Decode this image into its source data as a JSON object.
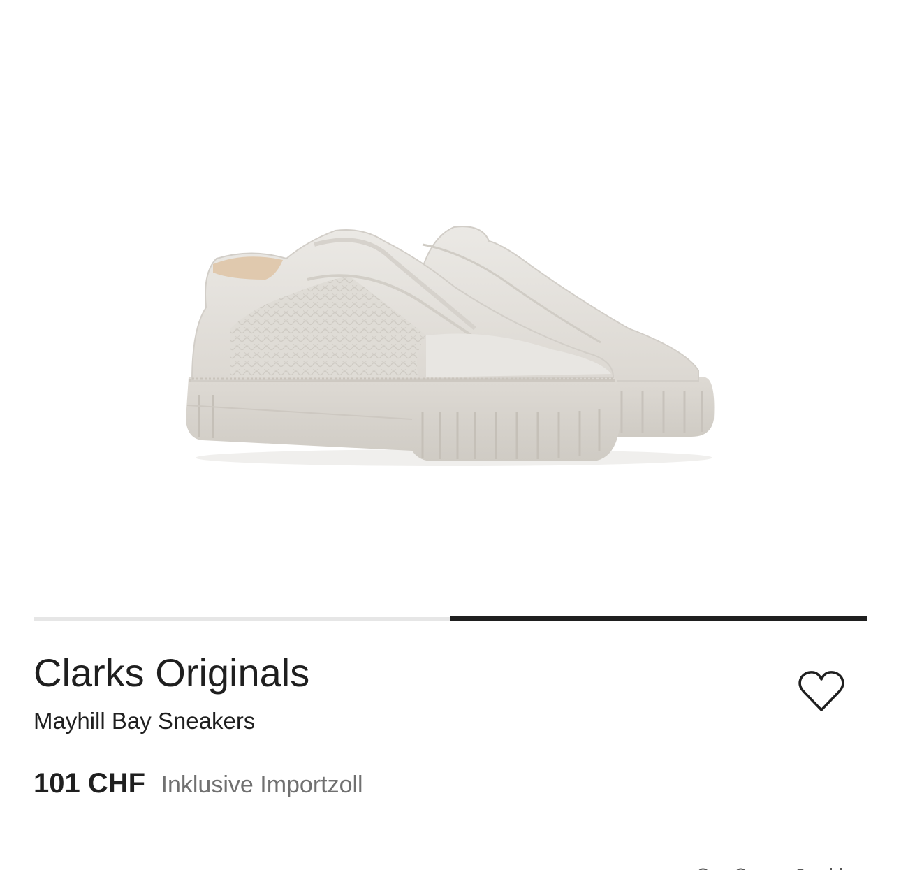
{
  "product": {
    "brand": "Clarks Originals",
    "name": "Mayhill Bay Sneakers",
    "price": "101 CHF",
    "price_note": "Inklusive Importzoll",
    "image_alt": "Mayhill Bay Sneakers product photo"
  },
  "carousel": {
    "total_slides": 2,
    "active_slide": 2
  },
  "icons": {
    "wishlist": "heart-outline-icon"
  },
  "colors": {
    "text_primary": "#1f1f1f",
    "text_secondary": "#707070",
    "indicator_active": "#1f1f1f",
    "indicator_inactive": "#e6e6e6",
    "shoe": "#e4e1dc"
  }
}
